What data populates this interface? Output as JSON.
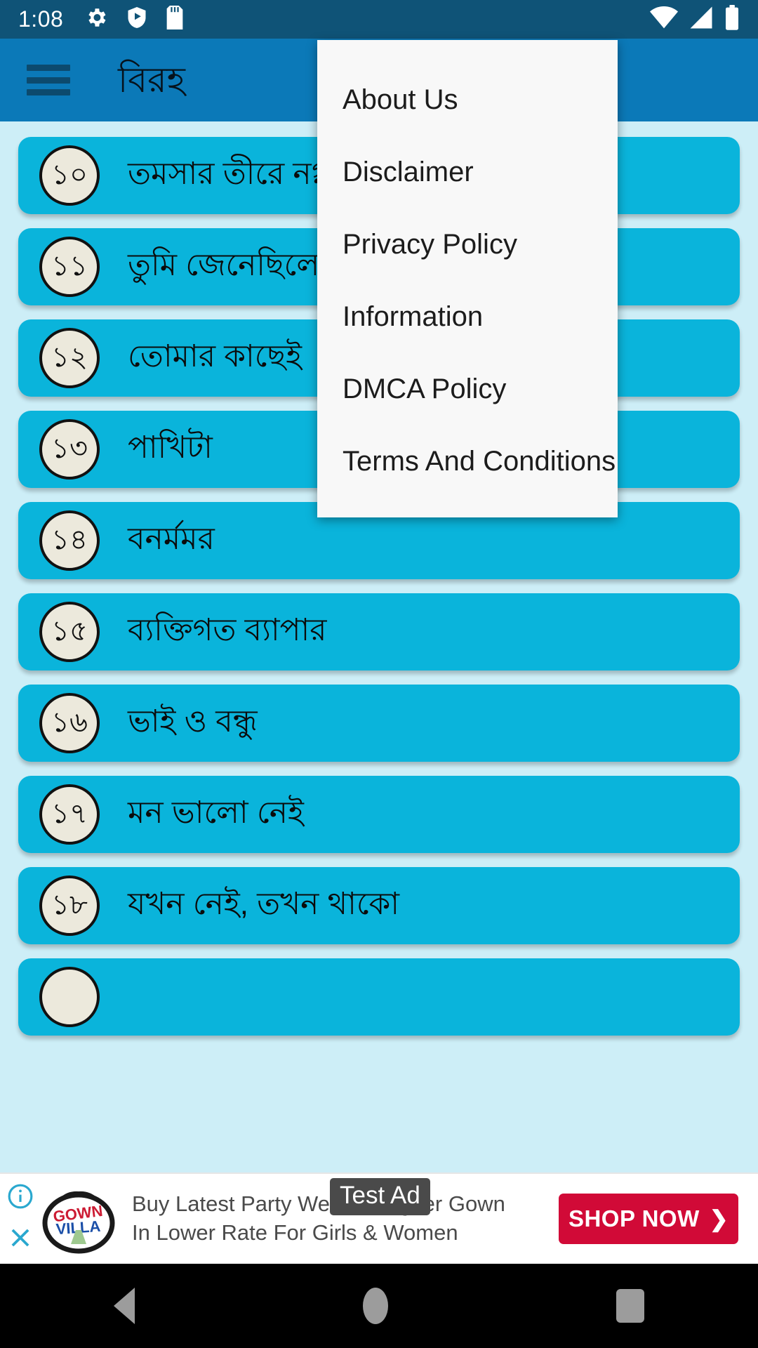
{
  "status_bar": {
    "time": "1:08",
    "left_icons": [
      "gear-icon",
      "play-protect-shield-icon",
      "sd-card-icon"
    ],
    "right_icons": [
      "wifi-icon",
      "cellular-signal-icon",
      "battery-icon"
    ],
    "background_color": "#0f5377"
  },
  "app_bar": {
    "menu_icon": "hamburger-menu-icon",
    "title": "বিরহ",
    "background_color": "#0b79b8"
  },
  "overflow_menu": {
    "visible": true,
    "background_color": "#f8f8f8",
    "items": [
      {
        "label": "About Us"
      },
      {
        "label": "Disclaimer"
      },
      {
        "label": "Privacy Policy"
      },
      {
        "label": "Information"
      },
      {
        "label": "DMCA Policy"
      },
      {
        "label": "Terms And Conditions"
      }
    ]
  },
  "list": {
    "background_color": "#cdeef7",
    "card_color": "#0ab4db",
    "badge_color": "#ece9dc",
    "items": [
      {
        "number": "১০",
        "title": "তমসার তীরে নগ্ন শরী"
      },
      {
        "number": "১১",
        "title": "তুমি জেনেছিলে"
      },
      {
        "number": "১২",
        "title": "তোমার কাছেই"
      },
      {
        "number": "১৩",
        "title": "পাখিটা"
      },
      {
        "number": "১৪",
        "title": "বনর্মমর"
      },
      {
        "number": "১৫",
        "title": "ব্যক্তিগত ব্যাপার"
      },
      {
        "number": "১৬",
        "title": "ভাই ও বন্ধু"
      },
      {
        "number": "১৭",
        "title": "মন ভালো নেই"
      },
      {
        "number": "১৮",
        "title": "যখন নেই, তখন থাকো"
      },
      {
        "number": "",
        "title": ""
      }
    ]
  },
  "ad": {
    "test_label": "Test Ad",
    "line1": "Buy Latest Party Wear Designer Gown",
    "line2": "In Lower Rate For Girls & Women",
    "cta_label": "SHOP NOW",
    "cta_chevron": "❯",
    "cta_color": "#d10a37",
    "logo_text_top": "GOWN",
    "logo_text_bottom": "VILLA",
    "info_icon": "ad-info-icon",
    "close_icon": "ad-close-icon"
  },
  "nav_bar": {
    "background_color": "#000000",
    "buttons": [
      "back-button",
      "home-button",
      "recents-button"
    ]
  }
}
